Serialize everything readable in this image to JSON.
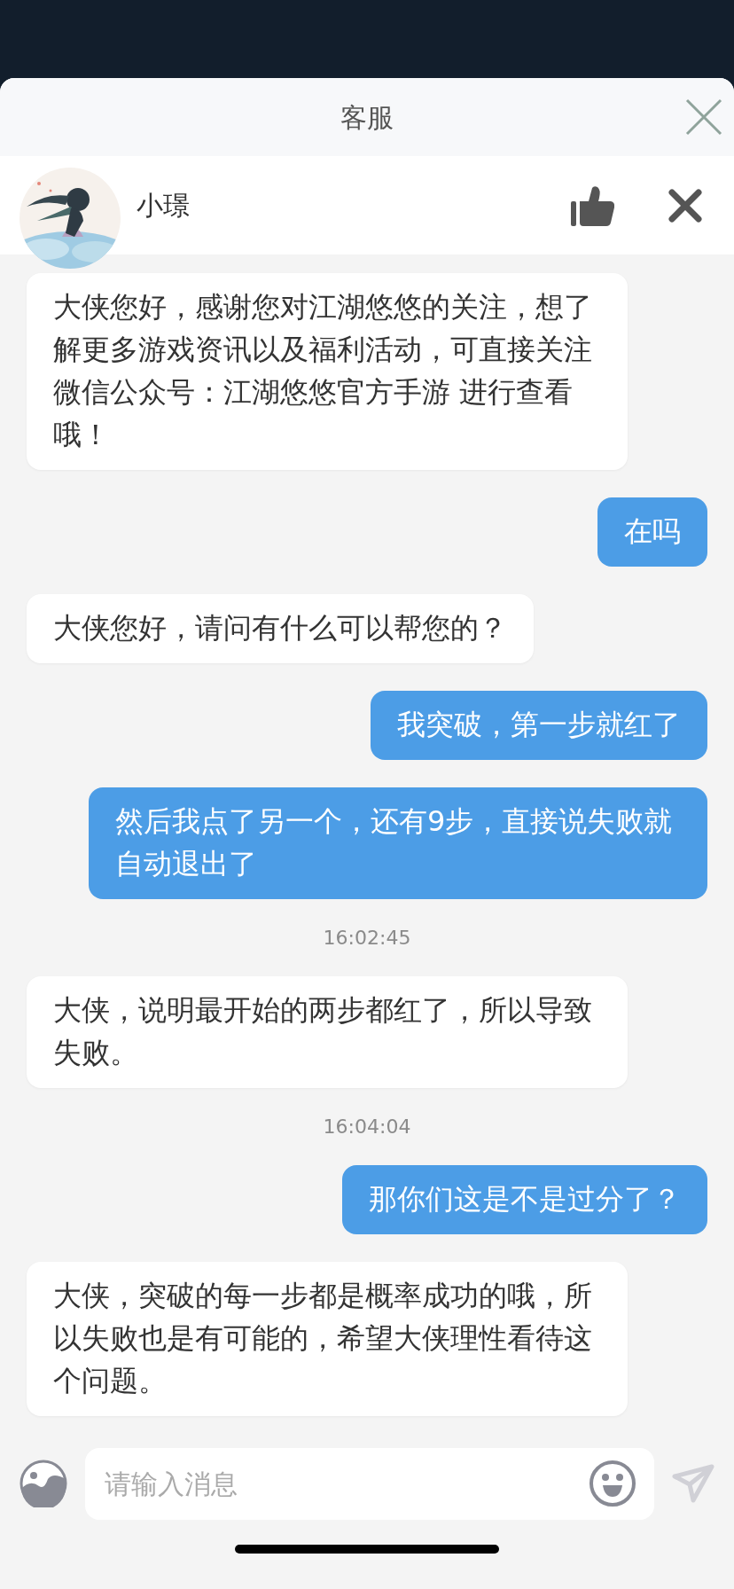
{
  "header": {
    "title": "客服"
  },
  "agent": {
    "name": "小璟"
  },
  "messages": [
    {
      "kind": "agent",
      "text": "大侠您好，感谢您对江湖悠悠的关注，想了解更多游戏资讯以及福利活动，可直接关注微信公众号：江湖悠悠官方手游 进行查看哦！"
    },
    {
      "kind": "user",
      "text": "在吗"
    },
    {
      "kind": "agent",
      "text": "大侠您好，请问有什么可以帮您的？"
    },
    {
      "kind": "user",
      "text": "我突破，第一步就红了"
    },
    {
      "kind": "user",
      "text": "然后我点了另一个，还有9步，直接说失败就自动退出了"
    },
    {
      "kind": "time",
      "text": "16:02:45"
    },
    {
      "kind": "agent",
      "text": "大侠，说明最开始的两步都红了，所以导致失败。"
    },
    {
      "kind": "time",
      "text": "16:04:04"
    },
    {
      "kind": "user",
      "text": "那你们这是不是过分了？"
    },
    {
      "kind": "agent",
      "text": "大侠，突破的每一步都是概率成功的哦，所以失败也是有可能的，希望大侠理性看待这个问题。"
    }
  ],
  "input": {
    "placeholder": "请输入消息"
  }
}
